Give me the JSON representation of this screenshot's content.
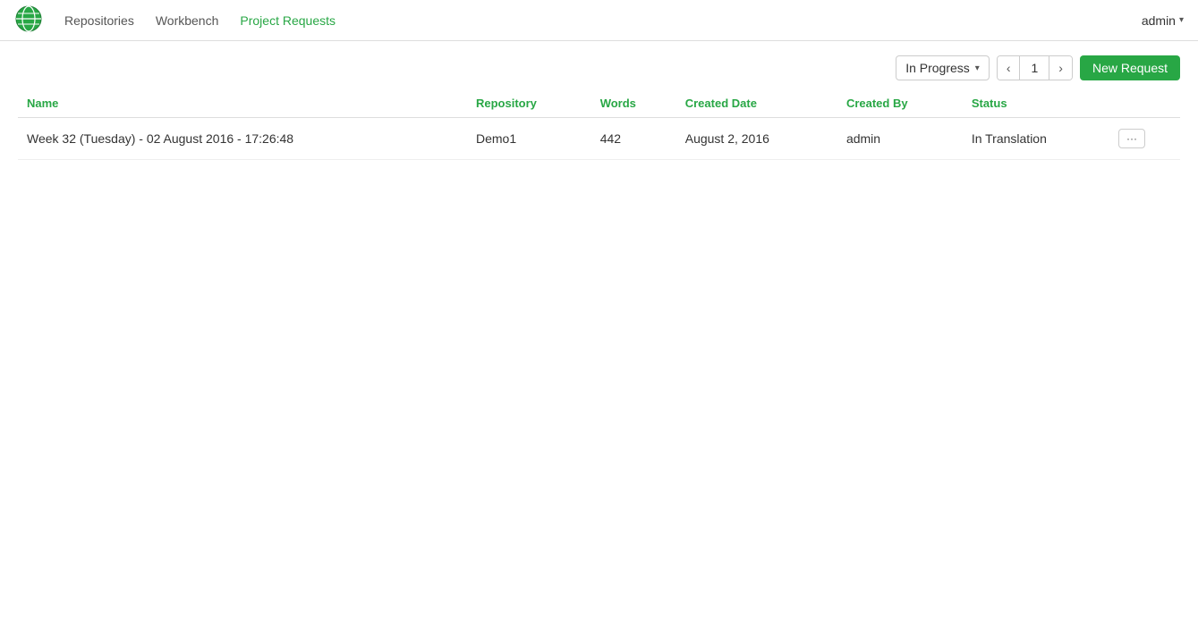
{
  "navbar": {
    "logo_alt": "globe-icon",
    "links": [
      {
        "label": "Repositories",
        "active": false
      },
      {
        "label": "Workbench",
        "active": false
      },
      {
        "label": "Project Requests",
        "active": true
      }
    ],
    "user": "admin",
    "user_caret": "▾"
  },
  "toolbar": {
    "filter_label": "In Progress",
    "filter_caret": "▾",
    "page_current": "1",
    "new_request_label": "New Request"
  },
  "table": {
    "columns": [
      {
        "key": "name",
        "label": "Name"
      },
      {
        "key": "repository",
        "label": "Repository"
      },
      {
        "key": "words",
        "label": "Words"
      },
      {
        "key": "created_date",
        "label": "Created Date"
      },
      {
        "key": "created_by",
        "label": "Created By"
      },
      {
        "key": "status",
        "label": "Status"
      },
      {
        "key": "actions",
        "label": ""
      }
    ],
    "rows": [
      {
        "name": "Week 32 (Tuesday) - 02 August 2016 - 17:26:48",
        "repository": "Demo1",
        "words": "442",
        "created_date": "August 2, 2016",
        "created_by": "admin",
        "status": "In Translation",
        "actions": "···"
      }
    ]
  }
}
